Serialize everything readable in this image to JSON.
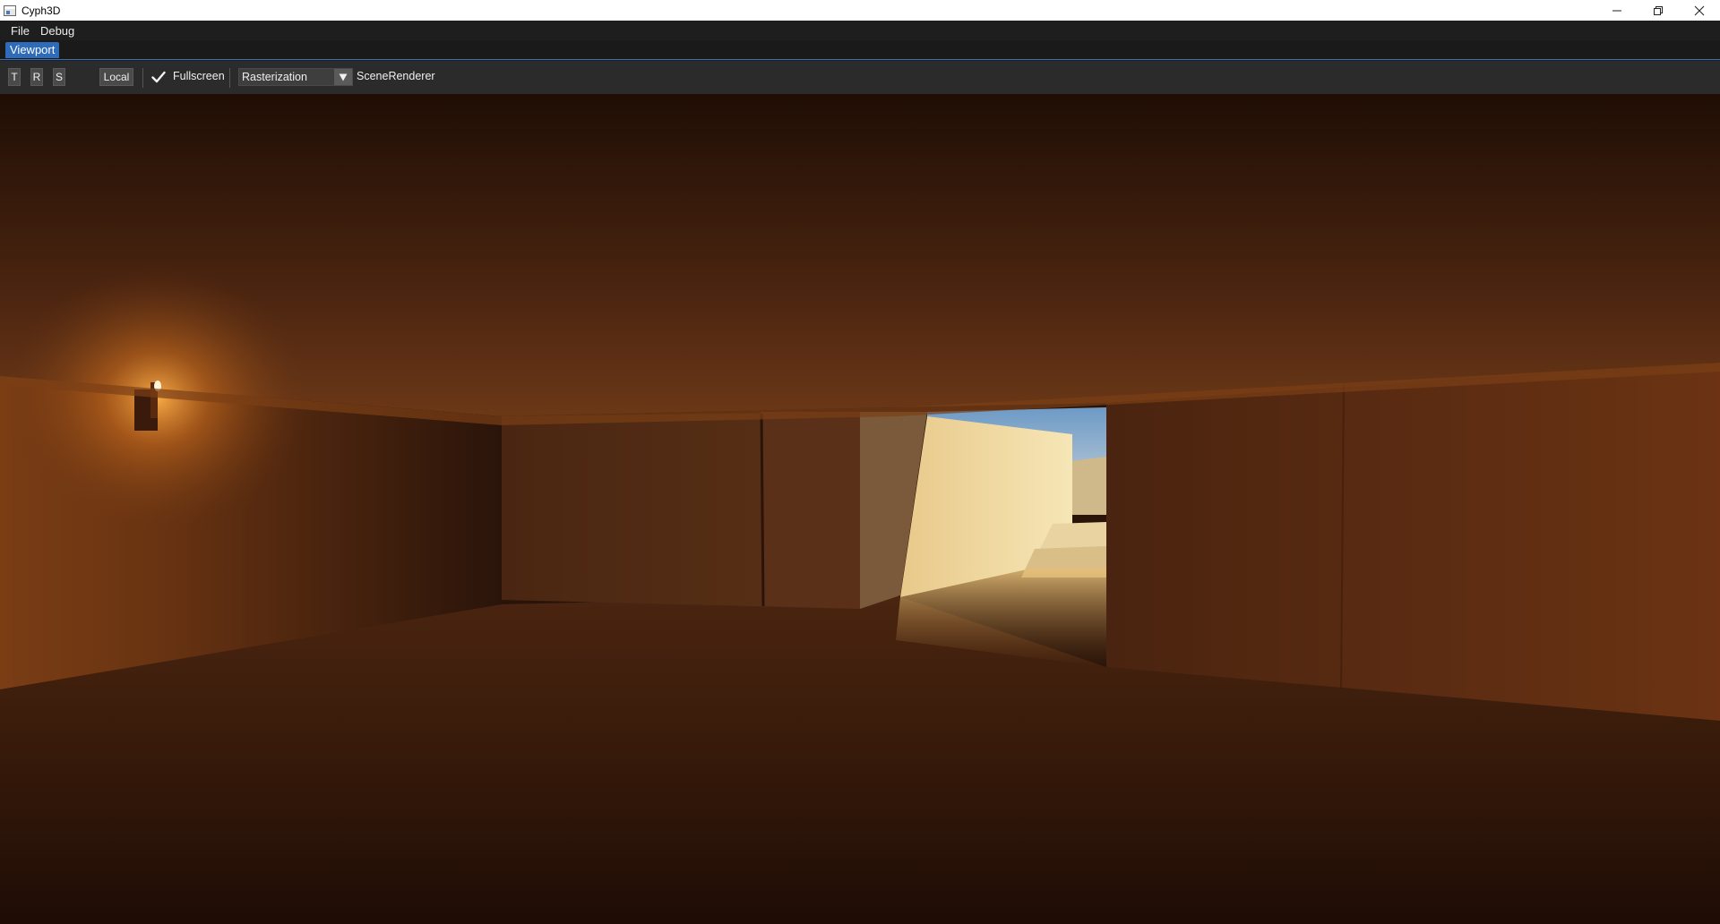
{
  "window": {
    "title": "Cyph3D",
    "controls": [
      "minimize",
      "maximize",
      "close"
    ]
  },
  "menu": {
    "items": [
      "File",
      "Debug"
    ]
  },
  "tabs": {
    "active": "Viewport"
  },
  "toolbar": {
    "translate_label": "T",
    "rotate_label": "R",
    "scale_label": "S",
    "space_label": "Local",
    "fullscreen_checked": true,
    "fullscreen_label": "Fullscreen",
    "renderer_mode": "Rasterization",
    "renderer_name": "SceneRenderer"
  },
  "colors": {
    "accent": "#2e6bb8",
    "toolbar_bg": "#2b2b2b",
    "menubar_bg": "#1e1e1e"
  }
}
